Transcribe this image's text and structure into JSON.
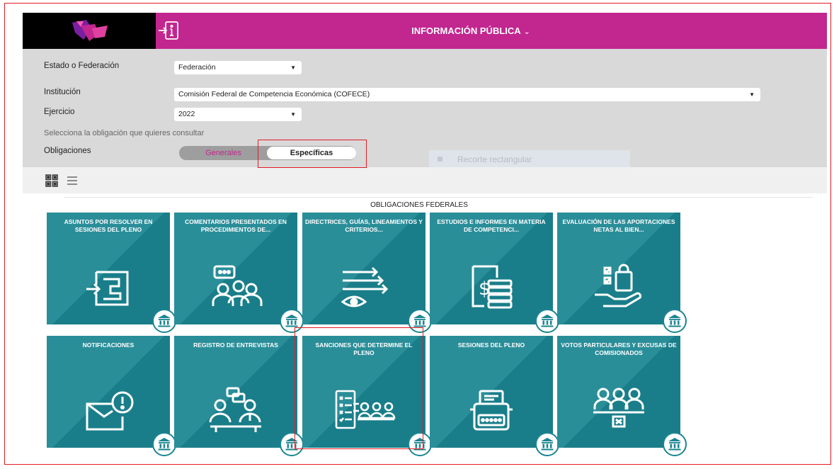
{
  "header": {
    "menu_label": "INFORMACIÓN PÚBLICA",
    "menu_caret": "⌄"
  },
  "filters": {
    "estado": {
      "label": "Estado o Federación",
      "value": "Federación"
    },
    "institucion": {
      "label": "Institución",
      "value": "Comisión Federal de Competencia Económica (COFECE)"
    },
    "ejercicio": {
      "label": "Ejercicio",
      "value": "2022"
    },
    "hint": "Selecciona la obligación que quieres consultar",
    "obligaciones": {
      "label": "Obligaciones",
      "generales": "Generales",
      "especificas": "Específicas",
      "selected": "Específicas"
    }
  },
  "ghost_tool": {
    "label": "Recorte rectangular"
  },
  "section": {
    "title": "OBLIGACIONES FEDERALES"
  },
  "tiles": [
    {
      "title": "ASUNTOS POR RESOLVER EN SESIONES DEL PLENO",
      "icon": "maze-arrow-icon"
    },
    {
      "title": "COMENTARIOS PRESENTADOS EN PROCEDIMIENTOS DE...",
      "icon": "people-comment-icon"
    },
    {
      "title": "DIRECTRICES, GUÍAS, LINEAMIENTOS Y CRITERIOS...",
      "icon": "eye-arrows-icon"
    },
    {
      "title": "ESTUDIOS E INFORMES EN MATERIA DE COMPETENCI...",
      "icon": "document-money-icon"
    },
    {
      "title": "EVALUACIÓN DE LAS APORTACIONES NETAS AL BIEN...",
      "icon": "hand-bag-icon"
    },
    {
      "title": "NOTIFICACIONES",
      "icon": "envelope-alert-icon"
    },
    {
      "title": "REGISTRO DE ENTREVISTAS",
      "icon": "interview-icon"
    },
    {
      "title": "SANCIONES QUE DETERMINE EL PLENO",
      "icon": "checklist-people-icon"
    },
    {
      "title": "SESIONES DEL PLENO",
      "icon": "typewriter-icon"
    },
    {
      "title": "VOTOS PARTICULARES Y EXCUSAS DE COMISIONADOS",
      "icon": "three-people-vote-icon"
    }
  ],
  "colors": {
    "magenta": "#c2268f",
    "teal": "#1a8591",
    "highlight": "#e31b23"
  }
}
